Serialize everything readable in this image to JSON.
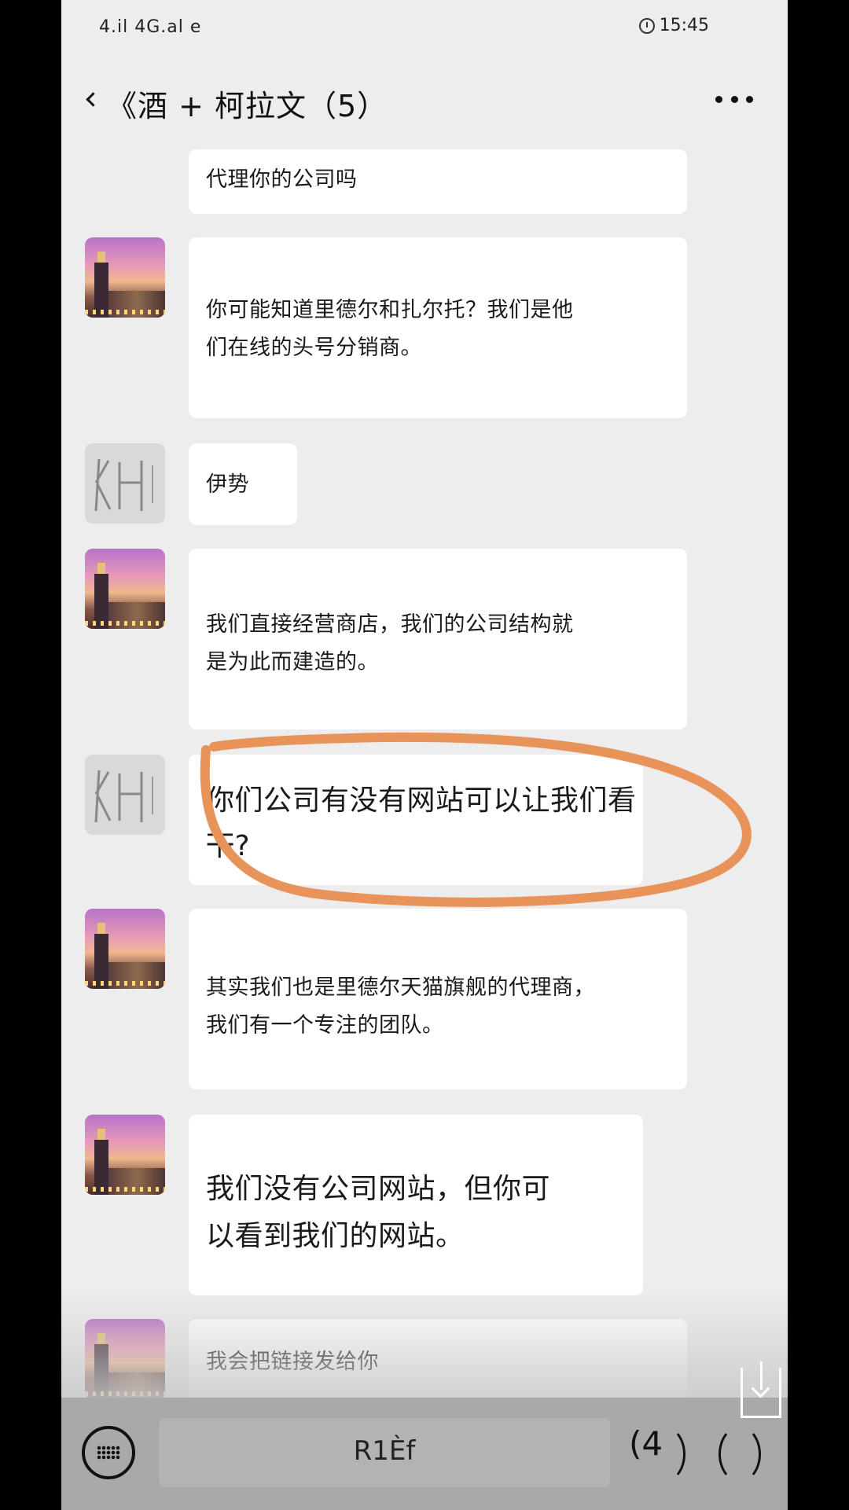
{
  "status_bar": {
    "signal": "4.il 4G.al e",
    "time": "15:45",
    "alarm_icon": "alarm-icon"
  },
  "header": {
    "title": "《酒 + 柯拉文（5）",
    "back_icon": "chevron-left-icon",
    "more_icon": "more-dots-icon"
  },
  "messages": [
    {
      "sender": "me",
      "avatar": "none",
      "text": "代理你的公司吗"
    },
    {
      "sender": "other",
      "avatar": "city-avatar",
      "line1": "你可能知道里德尔和扎尔托？我们是他",
      "line2": "们在线的头号分销商。"
    },
    {
      "sender": "me",
      "avatar": "sketch-avatar",
      "text": "伊势"
    },
    {
      "sender": "other",
      "avatar": "city-avatar",
      "line1": "我们直接经营商店，我们的公司结构就",
      "line2": "是为此而建造的。"
    },
    {
      "sender": "me",
      "avatar": "sketch-avatar",
      "line1": "你们公司有没有网站可以让我们看一",
      "line2": "下?"
    },
    {
      "sender": "other",
      "avatar": "city-avatar",
      "line1": "其实我们也是里德尔天猫旗舰的代理商，",
      "line2": "我们有一个专注的团队。"
    },
    {
      "sender": "other",
      "avatar": "city-avatar",
      "line1": "我们没有公司网站，但你可",
      "line2": "以看到我们的网站。"
    },
    {
      "sender": "other",
      "avatar": "city-avatar",
      "text": "我会把链接发给你"
    }
  ],
  "input_bar": {
    "keyboard_icon": "keyboard-icon",
    "hold_label": "R1Èf",
    "count": "(4"
  },
  "colors": {
    "screen_bg": "#ededed",
    "bubble_bg": "#ffffff",
    "annotation": "#e8935a",
    "input_bar_bg": "#a9a9a9"
  }
}
